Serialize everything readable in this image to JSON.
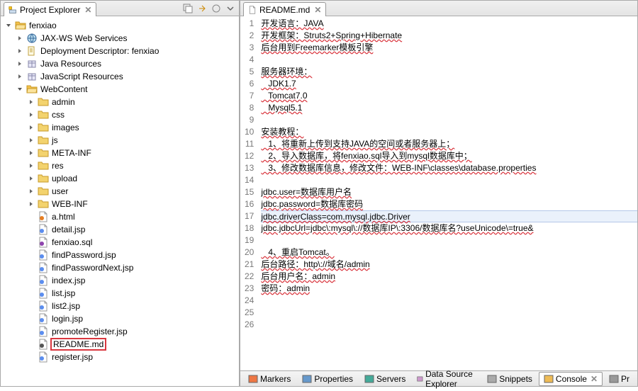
{
  "explorer": {
    "title": "Project Explorer",
    "root": "fenxiao",
    "items": [
      "JAX-WS Web Services",
      "Deployment Descriptor: fenxiao",
      "Java Resources",
      "JavaScript Resources"
    ],
    "webcontent": "WebContent",
    "folders": [
      "admin",
      "css",
      "images",
      "js",
      "META-INF",
      "res",
      "upload",
      "user",
      "WEB-INF"
    ],
    "files": [
      "a.html",
      "detail.jsp",
      "fenxiao.sql",
      "findPassword.jsp",
      "findPasswordNext.jsp",
      "index.jsp",
      "list.jsp",
      "list2.jsp",
      "login.jsp",
      "promoteRegister.jsp",
      "README.md",
      "register.jsp"
    ]
  },
  "editor": {
    "tab": "README.md",
    "lines": [
      "开发语言：JAVA",
      "开发框架：Struts2+Spring+Hibernate",
      "后台用到Freemarker模板引擎",
      "",
      "服务器环境：",
      "   JDK1.7",
      "   Tomcat7.0",
      "   Mysql5.1",
      "",
      "安装教程：",
      "   1、将重新上传到支持JAVA的空间或者服务器上；",
      "   2、导入数据库，将fenxiao.sql导入到mysql数据库中；",
      "   3、修改数据库信息，修改文件：WEB-INF\\classes\\database.properties",
      "",
      "jdbc.user=数据库用户名",
      "jdbc.password=数据库密码",
      "jdbc.driverClass=com.mysql.jdbc.Driver",
      "jdbc.jdbcUrl=jdbc\\:mysql\\://数据库IP\\:3306/数据库名?useUnicode\\=true&amp",
      "",
      "   4、重启Tomcat。",
      "后台路径：http\\://域名/admin",
      "后台用户名：admin",
      "密码：admin",
      "",
      "",
      ""
    ],
    "currentLine": 17,
    "underlineLines": [
      1,
      2,
      3,
      5,
      6,
      7,
      8,
      10,
      11,
      12,
      13,
      15,
      16,
      17,
      18,
      20,
      21,
      22,
      23
    ]
  },
  "status": {
    "tabs": [
      "Markers",
      "Properties",
      "Servers",
      "Data Source Explorer",
      "Snippets",
      "Console",
      "Pr"
    ]
  }
}
